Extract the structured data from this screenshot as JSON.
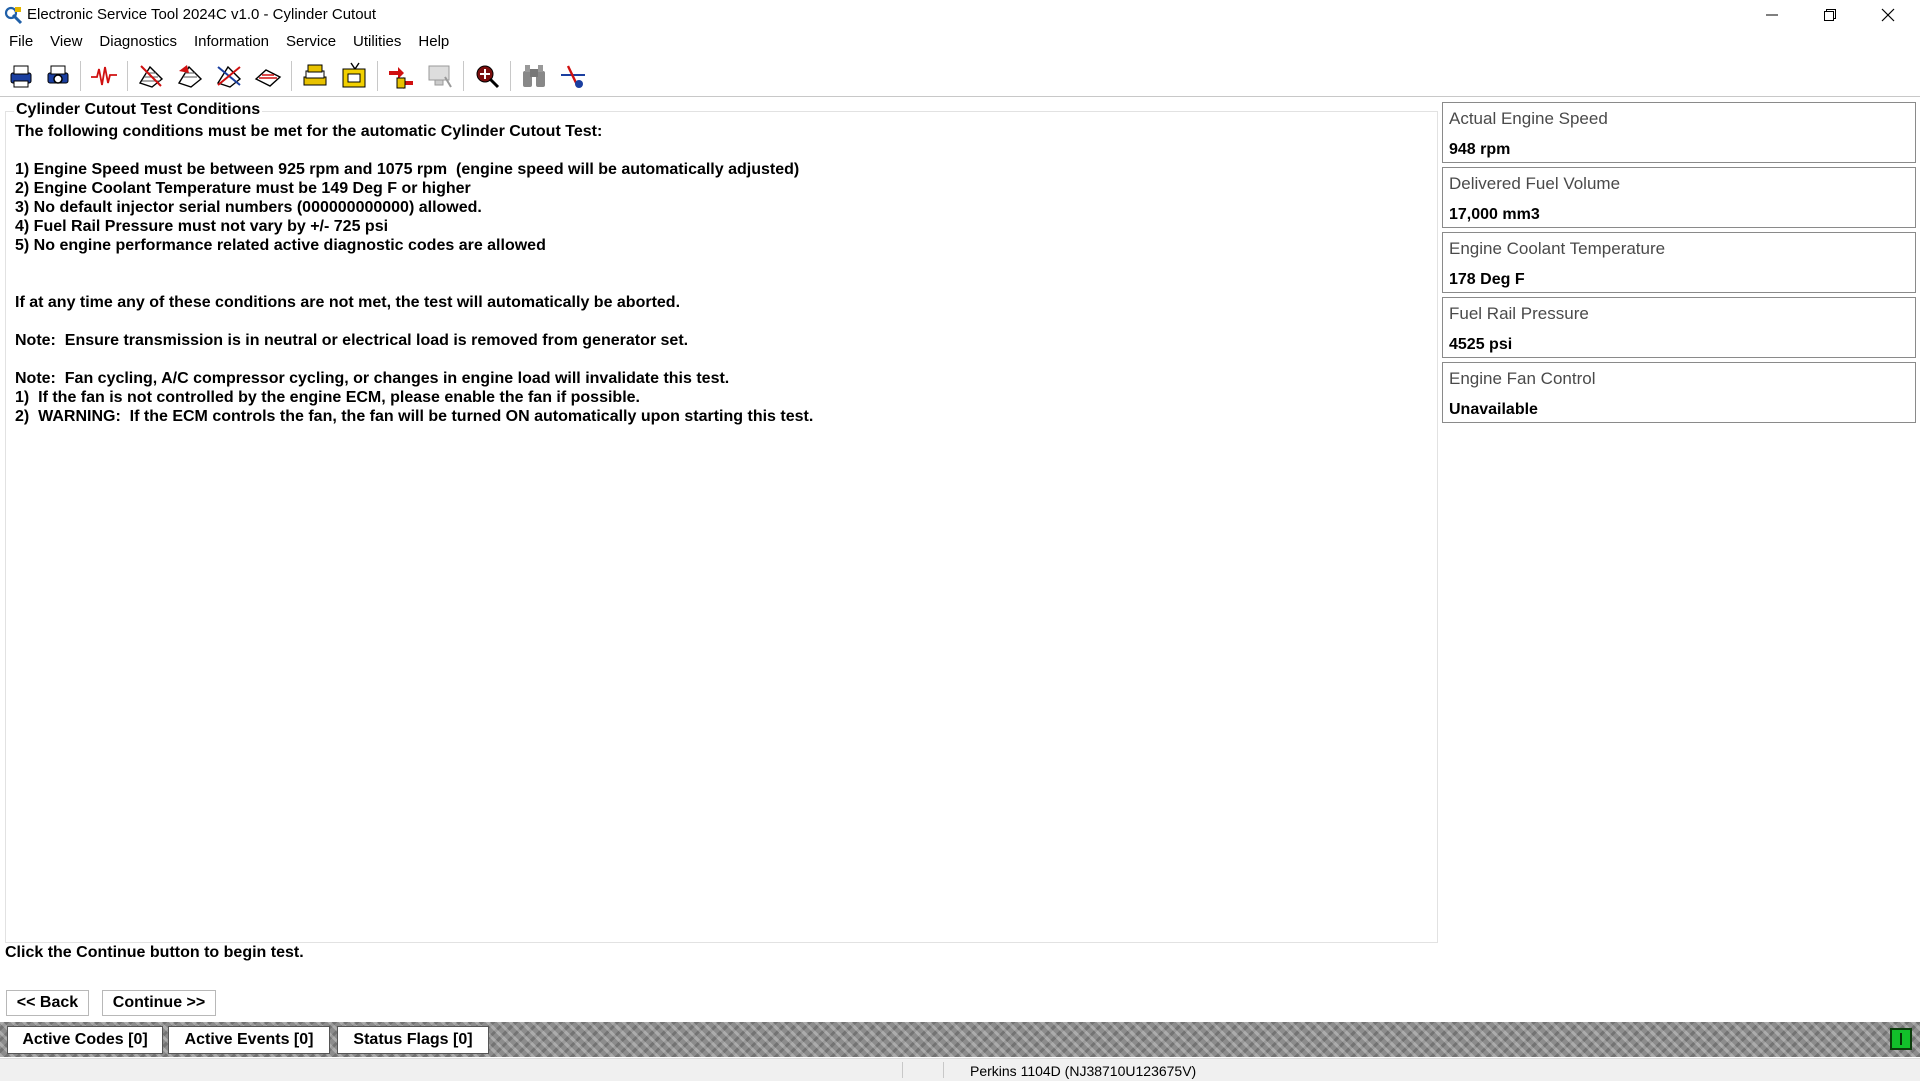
{
  "window": {
    "title": "Electronic Service Tool 2024C v1.0 - Cylinder Cutout"
  },
  "menu": [
    "File",
    "View",
    "Diagnostics",
    "Information",
    "Service",
    "Utilities",
    "Help"
  ],
  "toolbar_icons": [
    "print-icon",
    "print-preview-icon",
    "status-waveform-icon",
    "active-diagnostics-icon",
    "logged-diagnostics-icon",
    "events-icon",
    "clear-codes-icon",
    "configuration-icon",
    "flash-program-icon",
    "cylinder-cutout-icon",
    "override-icon",
    "ecm-summary-icon",
    "binoculars-icon",
    "data-link-icon"
  ],
  "conditions": {
    "group_label": "Cylinder Cutout Test Conditions",
    "lines": [
      "The following conditions must be met for the automatic Cylinder Cutout Test:",
      "",
      "1) Engine Speed must be between 925 rpm and 1075 rpm  (engine speed will be automatically adjusted)",
      "2) Engine Coolant Temperature must be 149 Deg F or higher",
      "3) No default injector serial numbers (000000000000) allowed.",
      "4) Fuel Rail Pressure must not vary by +/- 725 psi",
      "5) No engine performance related active diagnostic codes are allowed",
      "",
      "",
      "If at any time any of these conditions are not met, the test will automatically be aborted.",
      "",
      "Note:  Ensure transmission is in neutral or electrical load is removed from generator set.",
      "",
      "Note:  Fan cycling, A/C compressor cycling, or changes in engine load will invalidate this test.",
      "1)  If the fan is not controlled by the engine ECM, please enable the fan if possible.",
      "2)  WARNING:  If the ECM controls the fan, the fan will be turned ON automatically upon starting this test."
    ]
  },
  "parameters": [
    {
      "name": "Actual Engine Speed",
      "value": "948 rpm"
    },
    {
      "name": "Delivered Fuel Volume",
      "value": "17,000 mm3"
    },
    {
      "name": "Engine Coolant Temperature",
      "value": "178 Deg F"
    },
    {
      "name": "Fuel Rail Pressure",
      "value": "4525 psi"
    },
    {
      "name": "Engine Fan Control",
      "value": "Unavailable"
    }
  ],
  "instruction": "Click the Continue button to begin test.",
  "buttons": {
    "back": "<< Back",
    "continue": "Continue >>"
  },
  "status_tabs": {
    "active_codes": "Active Codes [0]",
    "active_events": "Active Events [0]",
    "status_flags": "Status Flags [0]"
  },
  "status_bar": {
    "ecm": "Perkins 1104D (NJ38710U123675V)"
  },
  "colors": {
    "connection_indicator": "#12c02a"
  }
}
